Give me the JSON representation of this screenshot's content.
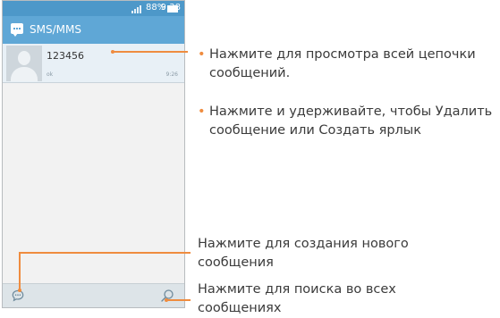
{
  "statusbar": {
    "battery": "88%",
    "time": "9:38"
  },
  "appbar": {
    "title": "SMS/MMS"
  },
  "thread": {
    "sender": "123456",
    "preview": "ok",
    "time": "9:26"
  },
  "annotations": {
    "bullet": "•",
    "view_thread": "Нажмите для просмотра всей цепочки сообщений.",
    "long_press": "Нажмите и удерживайте, чтобы Удалить сообщение или Создать ярлык",
    "new_message": "Нажмите для создания нового сообщения",
    "search": "Нажмите для поиска во всех сообщениях"
  },
  "colors": {
    "statusbar": "#4d98c9",
    "appbar": "#5fa7d6",
    "accent": "#ef8c3f"
  }
}
